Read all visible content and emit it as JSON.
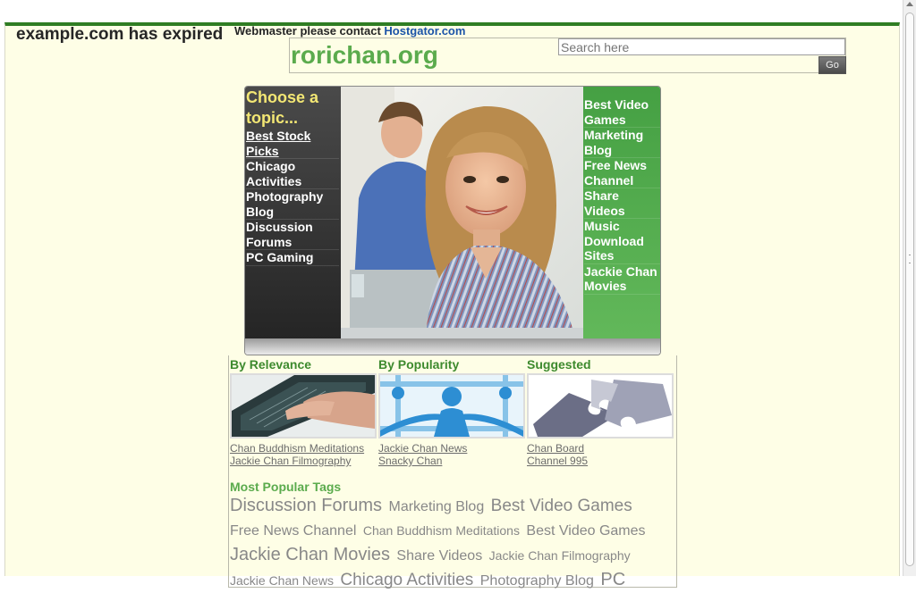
{
  "header": {
    "expired_text": "example.com has expired",
    "contact_prefix": "Webmaster please contact",
    "contact_link": "Hostgator.com",
    "site_name": "rorichan.org",
    "search_placeholder": "Search here",
    "go_label": "Go"
  },
  "banner": {
    "choose_label": "Choose a topic...",
    "left_topics": [
      "Best Stock Picks",
      "Chicago Activities",
      "Photography Blog",
      "Discussion Forums",
      "PC Gaming"
    ],
    "right_topics": [
      "Best Video Games",
      "Marketing Blog",
      "Free News Channel",
      "Share Videos",
      "Music Download Sites",
      "Jackie Chan Movies"
    ]
  },
  "columns": [
    {
      "heading": "By Relevance",
      "links": [
        "Chan Buddhism Meditations",
        "Jackie Chan Filmography"
      ]
    },
    {
      "heading": "By Popularity",
      "links": [
        "Jackie Chan News",
        "Snacky Chan"
      ]
    },
    {
      "heading": "Suggested",
      "links": [
        "Chan Board",
        "Channel 995"
      ]
    }
  ],
  "tags": {
    "heading": "Most Popular Tags",
    "items": [
      "Discussion Forums",
      "Marketing Blog",
      "Best Video Games",
      "Free News Channel",
      "Chan Buddhism Meditations",
      "Best Video Games",
      "Jackie Chan Movies",
      "Share Videos",
      "Jackie Chan Filmography",
      "Jackie Chan News",
      "Chicago Activities",
      "Photography Blog",
      "PC"
    ]
  },
  "colors": {
    "accent_green": "#5bab4d",
    "top_bar": "#2f7d23",
    "link_blue": "#1b53a8",
    "page_bg": "#fefee6"
  }
}
